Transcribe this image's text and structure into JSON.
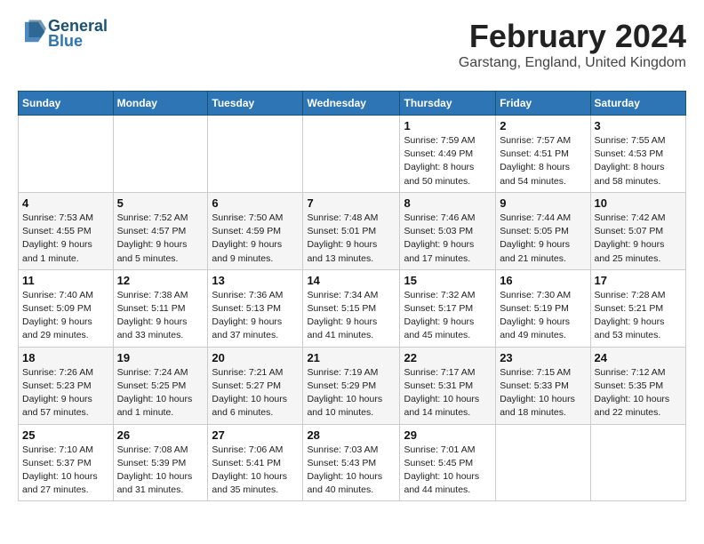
{
  "logo": {
    "line1": "General",
    "line2": "Blue"
  },
  "title": "February 2024",
  "subtitle": "Garstang, England, United Kingdom",
  "days_header": [
    "Sunday",
    "Monday",
    "Tuesday",
    "Wednesday",
    "Thursday",
    "Friday",
    "Saturday"
  ],
  "weeks": [
    [
      {
        "day": "",
        "info": ""
      },
      {
        "day": "",
        "info": ""
      },
      {
        "day": "",
        "info": ""
      },
      {
        "day": "",
        "info": ""
      },
      {
        "day": "1",
        "info": "Sunrise: 7:59 AM\nSunset: 4:49 PM\nDaylight: 8 hours\nand 50 minutes."
      },
      {
        "day": "2",
        "info": "Sunrise: 7:57 AM\nSunset: 4:51 PM\nDaylight: 8 hours\nand 54 minutes."
      },
      {
        "day": "3",
        "info": "Sunrise: 7:55 AM\nSunset: 4:53 PM\nDaylight: 8 hours\nand 58 minutes."
      }
    ],
    [
      {
        "day": "4",
        "info": "Sunrise: 7:53 AM\nSunset: 4:55 PM\nDaylight: 9 hours\nand 1 minute."
      },
      {
        "day": "5",
        "info": "Sunrise: 7:52 AM\nSunset: 4:57 PM\nDaylight: 9 hours\nand 5 minutes."
      },
      {
        "day": "6",
        "info": "Sunrise: 7:50 AM\nSunset: 4:59 PM\nDaylight: 9 hours\nand 9 minutes."
      },
      {
        "day": "7",
        "info": "Sunrise: 7:48 AM\nSunset: 5:01 PM\nDaylight: 9 hours\nand 13 minutes."
      },
      {
        "day": "8",
        "info": "Sunrise: 7:46 AM\nSunset: 5:03 PM\nDaylight: 9 hours\nand 17 minutes."
      },
      {
        "day": "9",
        "info": "Sunrise: 7:44 AM\nSunset: 5:05 PM\nDaylight: 9 hours\nand 21 minutes."
      },
      {
        "day": "10",
        "info": "Sunrise: 7:42 AM\nSunset: 5:07 PM\nDaylight: 9 hours\nand 25 minutes."
      }
    ],
    [
      {
        "day": "11",
        "info": "Sunrise: 7:40 AM\nSunset: 5:09 PM\nDaylight: 9 hours\nand 29 minutes."
      },
      {
        "day": "12",
        "info": "Sunrise: 7:38 AM\nSunset: 5:11 PM\nDaylight: 9 hours\nand 33 minutes."
      },
      {
        "day": "13",
        "info": "Sunrise: 7:36 AM\nSunset: 5:13 PM\nDaylight: 9 hours\nand 37 minutes."
      },
      {
        "day": "14",
        "info": "Sunrise: 7:34 AM\nSunset: 5:15 PM\nDaylight: 9 hours\nand 41 minutes."
      },
      {
        "day": "15",
        "info": "Sunrise: 7:32 AM\nSunset: 5:17 PM\nDaylight: 9 hours\nand 45 minutes."
      },
      {
        "day": "16",
        "info": "Sunrise: 7:30 AM\nSunset: 5:19 PM\nDaylight: 9 hours\nand 49 minutes."
      },
      {
        "day": "17",
        "info": "Sunrise: 7:28 AM\nSunset: 5:21 PM\nDaylight: 9 hours\nand 53 minutes."
      }
    ],
    [
      {
        "day": "18",
        "info": "Sunrise: 7:26 AM\nSunset: 5:23 PM\nDaylight: 9 hours\nand 57 minutes."
      },
      {
        "day": "19",
        "info": "Sunrise: 7:24 AM\nSunset: 5:25 PM\nDaylight: 10 hours\nand 1 minute."
      },
      {
        "day": "20",
        "info": "Sunrise: 7:21 AM\nSunset: 5:27 PM\nDaylight: 10 hours\nand 6 minutes."
      },
      {
        "day": "21",
        "info": "Sunrise: 7:19 AM\nSunset: 5:29 PM\nDaylight: 10 hours\nand 10 minutes."
      },
      {
        "day": "22",
        "info": "Sunrise: 7:17 AM\nSunset: 5:31 PM\nDaylight: 10 hours\nand 14 minutes."
      },
      {
        "day": "23",
        "info": "Sunrise: 7:15 AM\nSunset: 5:33 PM\nDaylight: 10 hours\nand 18 minutes."
      },
      {
        "day": "24",
        "info": "Sunrise: 7:12 AM\nSunset: 5:35 PM\nDaylight: 10 hours\nand 22 minutes."
      }
    ],
    [
      {
        "day": "25",
        "info": "Sunrise: 7:10 AM\nSunset: 5:37 PM\nDaylight: 10 hours\nand 27 minutes."
      },
      {
        "day": "26",
        "info": "Sunrise: 7:08 AM\nSunset: 5:39 PM\nDaylight: 10 hours\nand 31 minutes."
      },
      {
        "day": "27",
        "info": "Sunrise: 7:06 AM\nSunset: 5:41 PM\nDaylight: 10 hours\nand 35 minutes."
      },
      {
        "day": "28",
        "info": "Sunrise: 7:03 AM\nSunset: 5:43 PM\nDaylight: 10 hours\nand 40 minutes."
      },
      {
        "day": "29",
        "info": "Sunrise: 7:01 AM\nSunset: 5:45 PM\nDaylight: 10 hours\nand 44 minutes."
      },
      {
        "day": "",
        "info": ""
      },
      {
        "day": "",
        "info": ""
      }
    ]
  ]
}
